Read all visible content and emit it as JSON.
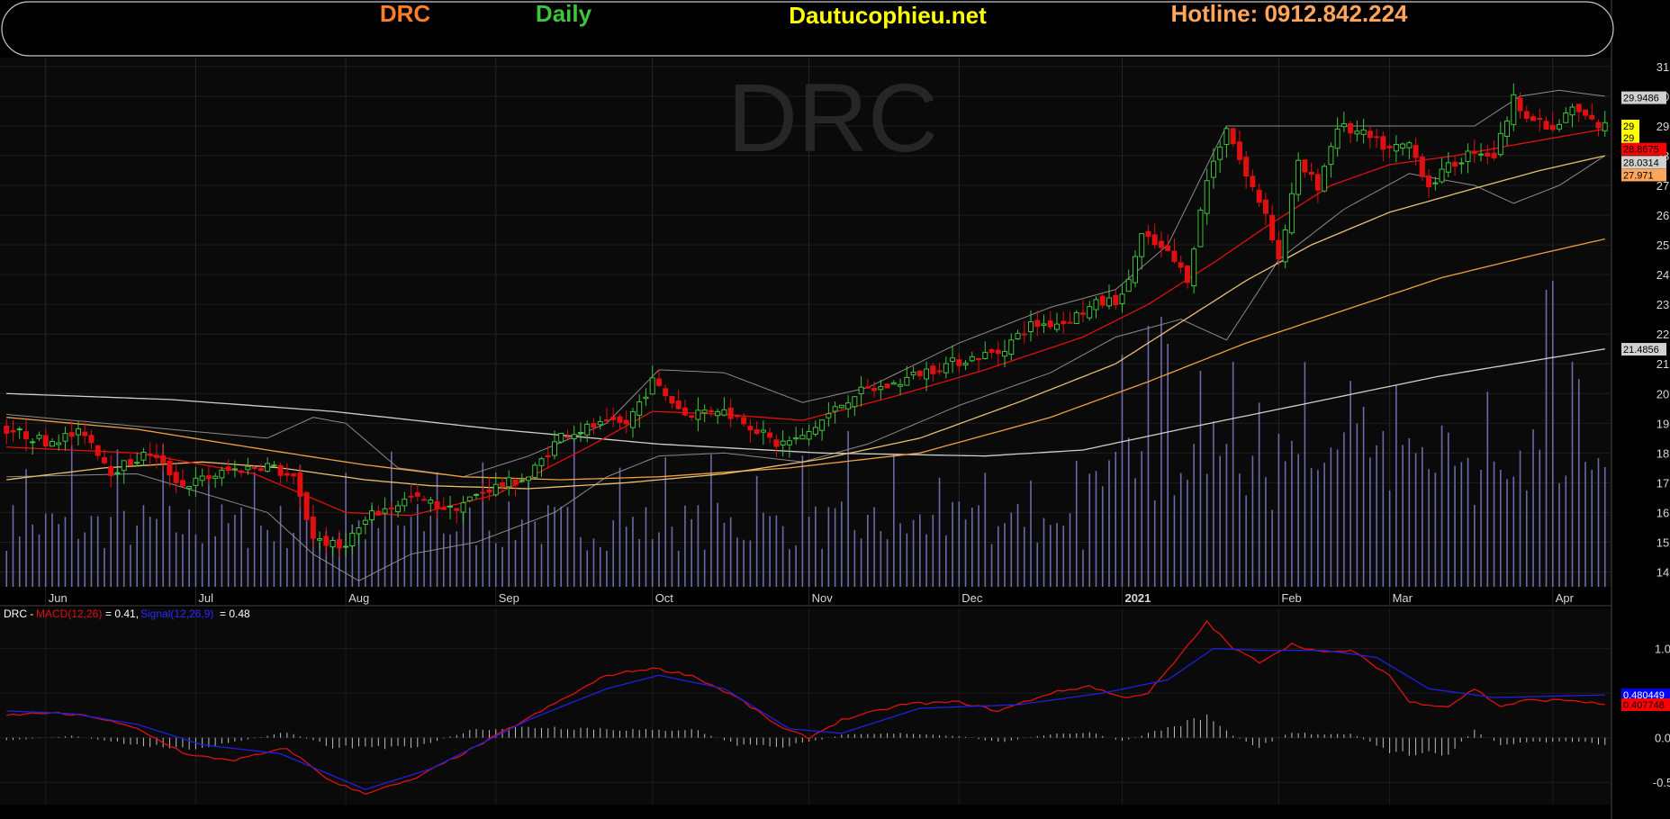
{
  "header": {
    "ticker": "DRC",
    "period": "Daily",
    "site": "Dautucophieu.net",
    "hotline": "Hotline: 0912.842.224",
    "colors": {
      "ticker": "#ff7f27",
      "period": "#3ec43e",
      "site": "#ffff00",
      "hotline": "#ffa65c"
    }
  },
  "chart_data": [
    {
      "type": "candlestick",
      "watermark": "DRC",
      "ylim": [
        13.5,
        31.3
      ],
      "y_ticks": [
        14,
        15,
        16,
        17,
        18,
        19,
        20,
        21,
        22,
        23,
        24,
        25,
        26,
        27,
        28,
        29,
        30,
        31
      ],
      "x_labels": [
        "Jun",
        "Jul",
        "Aug",
        "Sep",
        "Oct",
        "Nov",
        "Dec",
        "2021",
        "Feb",
        "Mar",
        "Apr"
      ],
      "x_label_positions": [
        6,
        29,
        52,
        75,
        99,
        123,
        146,
        171,
        195,
        212,
        237
      ],
      "x_range": [
        -1,
        246
      ],
      "grid": true,
      "axis_labels": [
        {
          "text": "29.9486",
          "value": 29.95,
          "bg": "#d0d0d0",
          "fg": "#000000"
        },
        {
          "text": "29",
          "value": 29.0,
          "bg": "#ffff00",
          "fg": "#000000"
        },
        {
          "text": "29",
          "value": 28.6,
          "bg": "#ffff00",
          "fg": "#000000"
        },
        {
          "text": "28.8675",
          "value": 28.22,
          "bg": "#ff0000",
          "fg": "#000000"
        },
        {
          "text": "28.0314",
          "value": 27.78,
          "bg": "#d0d0d0",
          "fg": "#000000"
        },
        {
          "text": "27.971",
          "value": 27.35,
          "bg": "#ffa65c",
          "fg": "#000000"
        },
        {
          "text": "21.4856",
          "value": 21.49,
          "bg": "#d0d0d0",
          "fg": "#000000"
        }
      ],
      "ohlc_waypoints": [
        [
          0,
          18.8
        ],
        [
          6,
          18.4
        ],
        [
          12,
          18.7
        ],
        [
          16,
          17.4
        ],
        [
          22,
          18.0
        ],
        [
          27,
          16.9
        ],
        [
          34,
          17.4
        ],
        [
          40,
          17.6
        ],
        [
          44,
          17.1
        ],
        [
          47,
          15.2
        ],
        [
          51,
          14.8
        ],
        [
          56,
          15.9
        ],
        [
          62,
          16.5
        ],
        [
          68,
          16.1
        ],
        [
          74,
          16.8
        ],
        [
          80,
          17.2
        ],
        [
          85,
          18.6
        ],
        [
          90,
          18.9
        ],
        [
          95,
          19.0
        ],
        [
          99,
          20.4
        ],
        [
          104,
          19.3
        ],
        [
          109,
          19.5
        ],
        [
          113,
          19.1
        ],
        [
          118,
          18.3
        ],
        [
          122,
          18.5
        ],
        [
          126,
          19.3
        ],
        [
          130,
          20.0
        ],
        [
          136,
          20.3
        ],
        [
          140,
          20.7
        ],
        [
          146,
          21.1
        ],
        [
          152,
          21.4
        ],
        [
          157,
          22.3
        ],
        [
          162,
          22.4
        ],
        [
          167,
          23.0
        ],
        [
          171,
          23.2
        ],
        [
          174,
          25.3
        ],
        [
          178,
          24.7
        ],
        [
          181,
          23.9
        ],
        [
          184,
          27.2
        ],
        [
          187,
          29.0
        ],
        [
          190,
          27.3
        ],
        [
          193,
          26.1
        ],
        [
          195,
          24.5
        ],
        [
          198,
          27.7
        ],
        [
          201,
          27.0
        ],
        [
          204,
          29.0
        ],
        [
          208,
          28.7
        ],
        [
          212,
          28.2
        ],
        [
          215,
          28.4
        ],
        [
          218,
          27.0
        ],
        [
          221,
          27.6
        ],
        [
          225,
          28.2
        ],
        [
          228,
          28.0
        ],
        [
          231,
          29.9
        ],
        [
          234,
          29.2
        ],
        [
          237,
          28.8
        ],
        [
          240,
          29.6
        ],
        [
          244,
          29.0
        ]
      ],
      "ma_fast_waypoints": [
        [
          0,
          18.2
        ],
        [
          20,
          18.0
        ],
        [
          38,
          17.3
        ],
        [
          52,
          16.0
        ],
        [
          62,
          15.9
        ],
        [
          75,
          16.6
        ],
        [
          90,
          18.3
        ],
        [
          99,
          19.4
        ],
        [
          110,
          19.3
        ],
        [
          122,
          19.1
        ],
        [
          136,
          19.9
        ],
        [
          150,
          20.8
        ],
        [
          165,
          21.9
        ],
        [
          175,
          23.0
        ],
        [
          185,
          24.4
        ],
        [
          193,
          25.6
        ],
        [
          203,
          27.0
        ],
        [
          212,
          27.7
        ],
        [
          222,
          28.0
        ],
        [
          232,
          28.4
        ],
        [
          245,
          28.9
        ]
      ],
      "bb_upper_waypoints": [
        [
          0,
          19.3
        ],
        [
          20,
          18.9
        ],
        [
          40,
          18.5
        ],
        [
          47,
          19.2
        ],
        [
          52,
          19.0
        ],
        [
          60,
          17.5
        ],
        [
          70,
          17.2
        ],
        [
          80,
          17.9
        ],
        [
          92,
          19.0
        ],
        [
          100,
          20.8
        ],
        [
          110,
          20.7
        ],
        [
          122,
          19.7
        ],
        [
          132,
          20.2
        ],
        [
          146,
          21.7
        ],
        [
          160,
          22.9
        ],
        [
          170,
          23.5
        ],
        [
          178,
          25.0
        ],
        [
          187,
          29.0
        ],
        [
          195,
          29.0
        ],
        [
          205,
          29.0
        ],
        [
          215,
          29.0
        ],
        [
          225,
          29.0
        ],
        [
          232,
          30.0
        ],
        [
          238,
          30.2
        ],
        [
          245,
          30.0
        ]
      ],
      "bb_lower_waypoints": [
        [
          0,
          17.2
        ],
        [
          20,
          17.3
        ],
        [
          40,
          16.0
        ],
        [
          47,
          14.6
        ],
        [
          54,
          13.7
        ],
        [
          62,
          14.6
        ],
        [
          72,
          15.0
        ],
        [
          84,
          16.0
        ],
        [
          92,
          17.2
        ],
        [
          100,
          17.9
        ],
        [
          110,
          18.0
        ],
        [
          122,
          17.7
        ],
        [
          132,
          18.3
        ],
        [
          146,
          19.6
        ],
        [
          160,
          20.7
        ],
        [
          170,
          21.9
        ],
        [
          180,
          22.5
        ],
        [
          187,
          21.8
        ],
        [
          195,
          24.5
        ],
        [
          205,
          26.2
        ],
        [
          215,
          27.4
        ],
        [
          225,
          27.0
        ],
        [
          231,
          26.4
        ],
        [
          238,
          27.0
        ],
        [
          245,
          28.0
        ]
      ],
      "ma_mid_waypoints": [
        [
          0,
          17.1
        ],
        [
          15,
          17.5
        ],
        [
          30,
          17.7
        ],
        [
          42,
          17.5
        ],
        [
          55,
          17.1
        ],
        [
          65,
          16.9
        ],
        [
          80,
          16.8
        ],
        [
          95,
          17.0
        ],
        [
          110,
          17.3
        ],
        [
          125,
          17.8
        ],
        [
          140,
          18.5
        ],
        [
          155,
          19.7
        ],
        [
          170,
          21.0
        ],
        [
          180,
          22.4
        ],
        [
          190,
          23.8
        ],
        [
          200,
          25.0
        ],
        [
          212,
          26.1
        ],
        [
          225,
          26.9
        ],
        [
          235,
          27.5
        ],
        [
          245,
          28.0
        ]
      ],
      "ma_slow_waypoints": [
        [
          0,
          19.2
        ],
        [
          20,
          18.8
        ],
        [
          40,
          18.1
        ],
        [
          55,
          17.6
        ],
        [
          70,
          17.2
        ],
        [
          85,
          17.1
        ],
        [
          100,
          17.2
        ],
        [
          120,
          17.5
        ],
        [
          140,
          18.0
        ],
        [
          160,
          19.2
        ],
        [
          175,
          20.4
        ],
        [
          190,
          21.7
        ],
        [
          205,
          22.8
        ],
        [
          220,
          23.9
        ],
        [
          235,
          24.7
        ],
        [
          245,
          25.2
        ]
      ],
      "ma_long_waypoints": [
        [
          0,
          20.0
        ],
        [
          25,
          19.8
        ],
        [
          50,
          19.4
        ],
        [
          75,
          18.8
        ],
        [
          100,
          18.3
        ],
        [
          125,
          18.0
        ],
        [
          150,
          17.9
        ],
        [
          165,
          18.1
        ],
        [
          180,
          18.8
        ],
        [
          200,
          19.7
        ],
        [
          220,
          20.6
        ],
        [
          245,
          21.5
        ]
      ]
    },
    {
      "type": "line",
      "label_prefix": "DRC -",
      "macd_label": "MACD(12,26)",
      "macd_value": "= 0.41,",
      "signal_label": "Signal(12,26,9)",
      "signal_value": "= 0.48",
      "ylim": [
        -0.75,
        1.45
      ],
      "y_ticks": [
        "1.0",
        "0.5",
        "0.0",
        "-0.5"
      ],
      "y_tick_values": [
        1.0,
        0.5,
        0.0,
        -0.5
      ],
      "axis_labels": [
        {
          "text": "0.480449",
          "value": 0.48,
          "bg": "#0000ff",
          "fg": "#ffffff"
        },
        {
          "text": "0.407748",
          "value": 0.37,
          "bg": "#ff0000",
          "fg": "#000000"
        }
      ],
      "series": [
        {
          "key": "macd",
          "color": "#e01010",
          "waypoints": [
            [
              0,
              0.25
            ],
            [
              6,
              0.28
            ],
            [
              13,
              0.24
            ],
            [
              20,
              0.1
            ],
            [
              28,
              -0.2
            ],
            [
              35,
              -0.25
            ],
            [
              43,
              -0.12
            ],
            [
              50,
              -0.5
            ],
            [
              55,
              -0.62
            ],
            [
              62,
              -0.48
            ],
            [
              72,
              -0.1
            ],
            [
              82,
              0.3
            ],
            [
              92,
              0.7
            ],
            [
              99,
              0.78
            ],
            [
              105,
              0.7
            ],
            [
              112,
              0.45
            ],
            [
              119,
              0.1
            ],
            [
              123,
              0.0
            ],
            [
              128,
              0.2
            ],
            [
              138,
              0.38
            ],
            [
              146,
              0.4
            ],
            [
              152,
              0.3
            ],
            [
              160,
              0.5
            ],
            [
              166,
              0.58
            ],
            [
              171,
              0.45
            ],
            [
              175,
              0.5
            ],
            [
              180,
              0.93
            ],
            [
              184,
              1.3
            ],
            [
              188,
              1.0
            ],
            [
              192,
              0.85
            ],
            [
              197,
              1.05
            ],
            [
              202,
              0.95
            ],
            [
              206,
              0.98
            ],
            [
              212,
              0.7
            ],
            [
              215,
              0.4
            ],
            [
              221,
              0.35
            ],
            [
              225,
              0.55
            ],
            [
              229,
              0.35
            ],
            [
              233,
              0.42
            ],
            [
              240,
              0.42
            ],
            [
              245,
              0.37
            ]
          ]
        },
        {
          "key": "signal",
          "color": "#2020e0",
          "waypoints": [
            [
              0,
              0.3
            ],
            [
              10,
              0.27
            ],
            [
              20,
              0.15
            ],
            [
              30,
              -0.08
            ],
            [
              42,
              -0.18
            ],
            [
              55,
              -0.58
            ],
            [
              65,
              -0.35
            ],
            [
              80,
              0.2
            ],
            [
              92,
              0.55
            ],
            [
              100,
              0.7
            ],
            [
              110,
              0.55
            ],
            [
              120,
              0.1
            ],
            [
              128,
              0.05
            ],
            [
              140,
              0.33
            ],
            [
              155,
              0.37
            ],
            [
              168,
              0.5
            ],
            [
              178,
              0.65
            ],
            [
              185,
              1.0
            ],
            [
              192,
              0.98
            ],
            [
              202,
              0.98
            ],
            [
              210,
              0.9
            ],
            [
              218,
              0.55
            ],
            [
              228,
              0.45
            ],
            [
              245,
              0.48
            ]
          ]
        }
      ],
      "histogram_waypoints": [
        [
          0,
          -0.03
        ],
        [
          10,
          0.02
        ],
        [
          20,
          -0.08
        ],
        [
          28,
          -0.12
        ],
        [
          35,
          -0.05
        ],
        [
          43,
          0.06
        ],
        [
          50,
          -0.1
        ],
        [
          56,
          -0.1
        ],
        [
          62,
          -0.12
        ],
        [
          72,
          0.1
        ],
        [
          82,
          0.12
        ],
        [
          92,
          0.1
        ],
        [
          99,
          0.08
        ],
        [
          105,
          0.1
        ],
        [
          112,
          -0.08
        ],
        [
          119,
          -0.1
        ],
        [
          123,
          -0.05
        ],
        [
          128,
          0.03
        ],
        [
          138,
          0.05
        ],
        [
          146,
          0.02
        ],
        [
          152,
          -0.05
        ],
        [
          160,
          0.04
        ],
        [
          166,
          0.06
        ],
        [
          171,
          -0.04
        ],
        [
          175,
          0.05
        ],
        [
          180,
          0.15
        ],
        [
          184,
          0.24
        ],
        [
          188,
          0.02
        ],
        [
          192,
          -0.1
        ],
        [
          197,
          0.06
        ],
        [
          202,
          0.03
        ],
        [
          206,
          0.05
        ],
        [
          212,
          -0.16
        ],
        [
          215,
          -0.2
        ],
        [
          221,
          -0.17
        ],
        [
          225,
          0.08
        ],
        [
          229,
          -0.08
        ],
        [
          233,
          -0.05
        ],
        [
          240,
          -0.04
        ],
        [
          245,
          -0.07
        ]
      ]
    }
  ],
  "colors": {
    "background": "#000000",
    "grid": "#1e1e1e",
    "up": "#3ec43e",
    "down": "#e01010",
    "bollinger": "#8a8a8a",
    "ma_fast": "#e01010",
    "ma_mid": "#e8c070",
    "ma_slow": "#f0a040",
    "ma_long": "#cfcfcf",
    "volume": "#6a6aa8",
    "macd_hist": "#bfbfbf"
  }
}
